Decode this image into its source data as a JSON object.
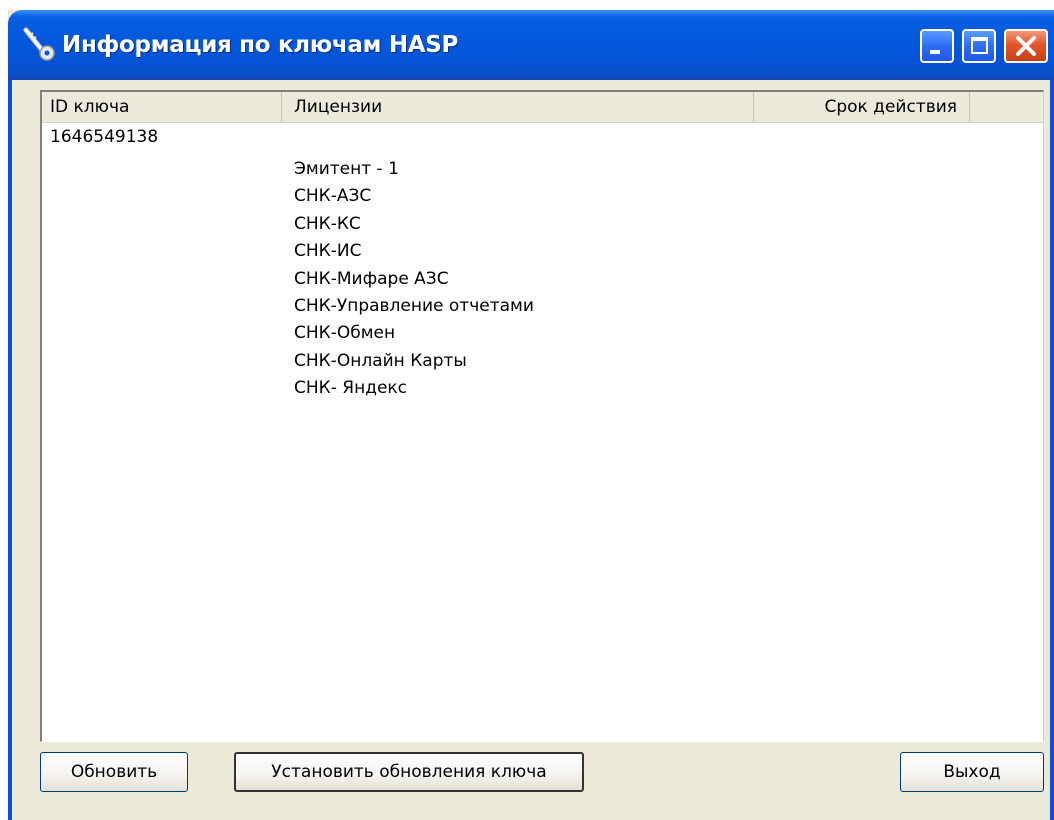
{
  "window": {
    "title": "Информация по ключам HASP"
  },
  "title_buttons": {
    "minimize_icon": "minimize-icon",
    "maximize_icon": "maximize-icon",
    "close_icon": "close-icon"
  },
  "table": {
    "columns": [
      "ID ключа",
      "Лицензии",
      "Срок действия"
    ],
    "key_id": "1646549138",
    "licenses": [
      "Эмитент - 1",
      "СНК-АЗС",
      "СНК-КС",
      "СНК-ИС",
      "СНК-Мифаре АЗС",
      "СНК-Управление отчетами",
      "СНК-Обмен",
      "СНК-Онлайн Карты",
      "СНК- Яндекс"
    ]
  },
  "buttons": {
    "refresh": "Обновить",
    "install_updates": "Установить обновления ключа",
    "exit": "Выход"
  },
  "colors": {
    "titlebar": "#0458dc",
    "window_face": "#ece9d8",
    "close_button": "#e2562d"
  }
}
